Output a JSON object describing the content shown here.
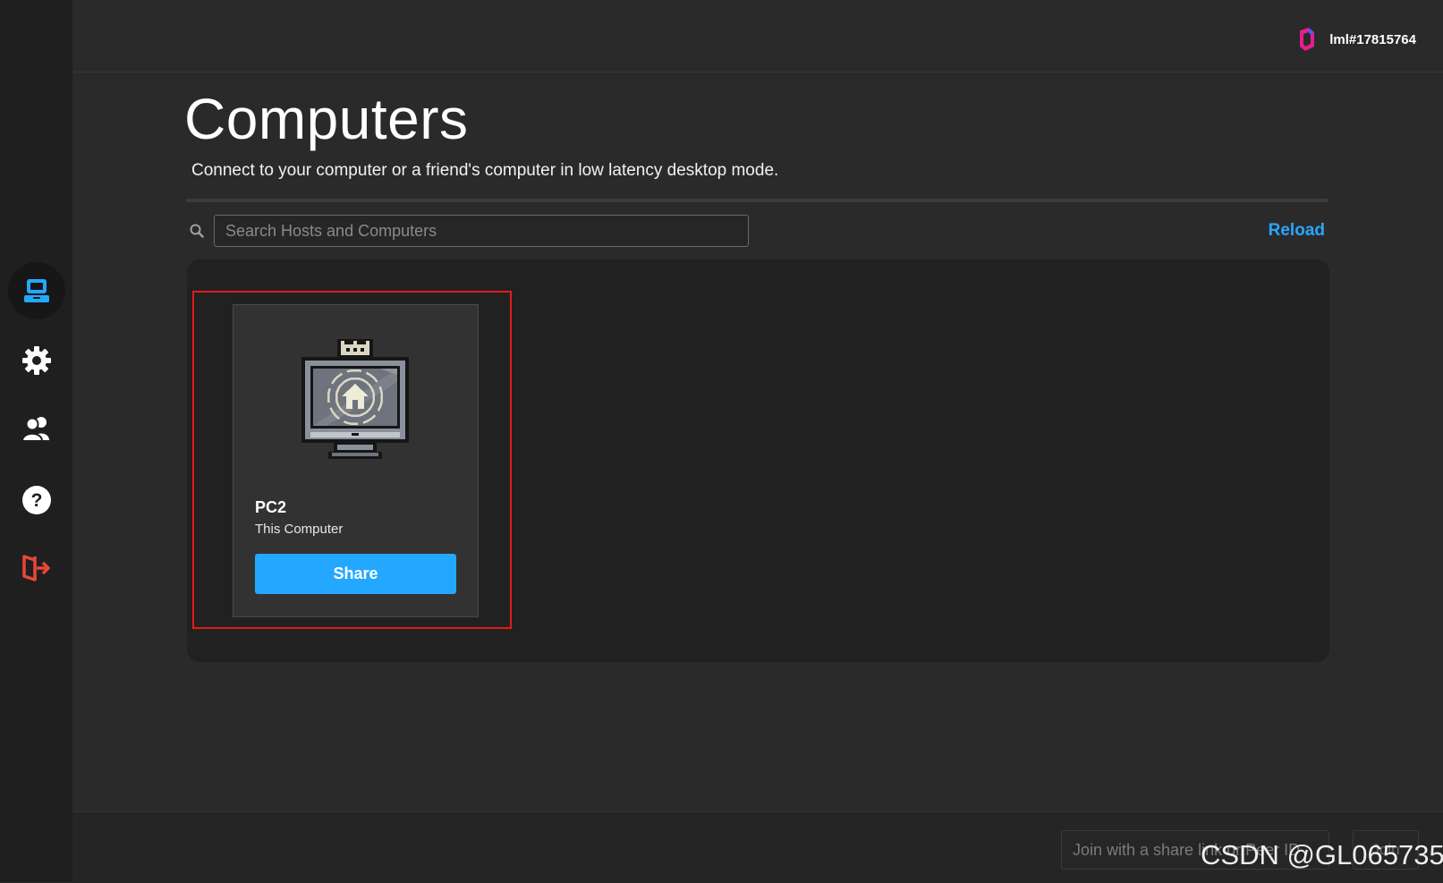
{
  "user": {
    "username": "lml#17815764",
    "logo_icon": "parsec-logo-icon"
  },
  "sidebar": {
    "items": [
      {
        "icon": "computer-icon",
        "active": true
      },
      {
        "icon": "gear-icon",
        "active": false
      },
      {
        "icon": "friends-icon",
        "active": false
      },
      {
        "icon": "help-icon",
        "active": false
      },
      {
        "icon": "logout-icon",
        "active": false
      }
    ]
  },
  "main": {
    "title": "Computers",
    "subtitle": "Connect to your computer or a friend's computer in low latency desktop mode.",
    "search": {
      "placeholder": "Search Hosts and Computers",
      "value": ""
    },
    "reload_label": "Reload",
    "computers": [
      {
        "name": "PC2",
        "description": "This Computer",
        "share_label": "Share",
        "icon": "home-monitor-icon"
      }
    ]
  },
  "footer": {
    "join_placeholder": "Join with a share link or Peer ID",
    "join_button_label": "Join"
  },
  "watermark": "CSDN @GL065735",
  "colors": {
    "accent": "#24a8ff",
    "logout": "#e8463a",
    "highlight": "#e01b1b",
    "background": "#2a2a2a",
    "sidebar": "#1f1f1f"
  }
}
